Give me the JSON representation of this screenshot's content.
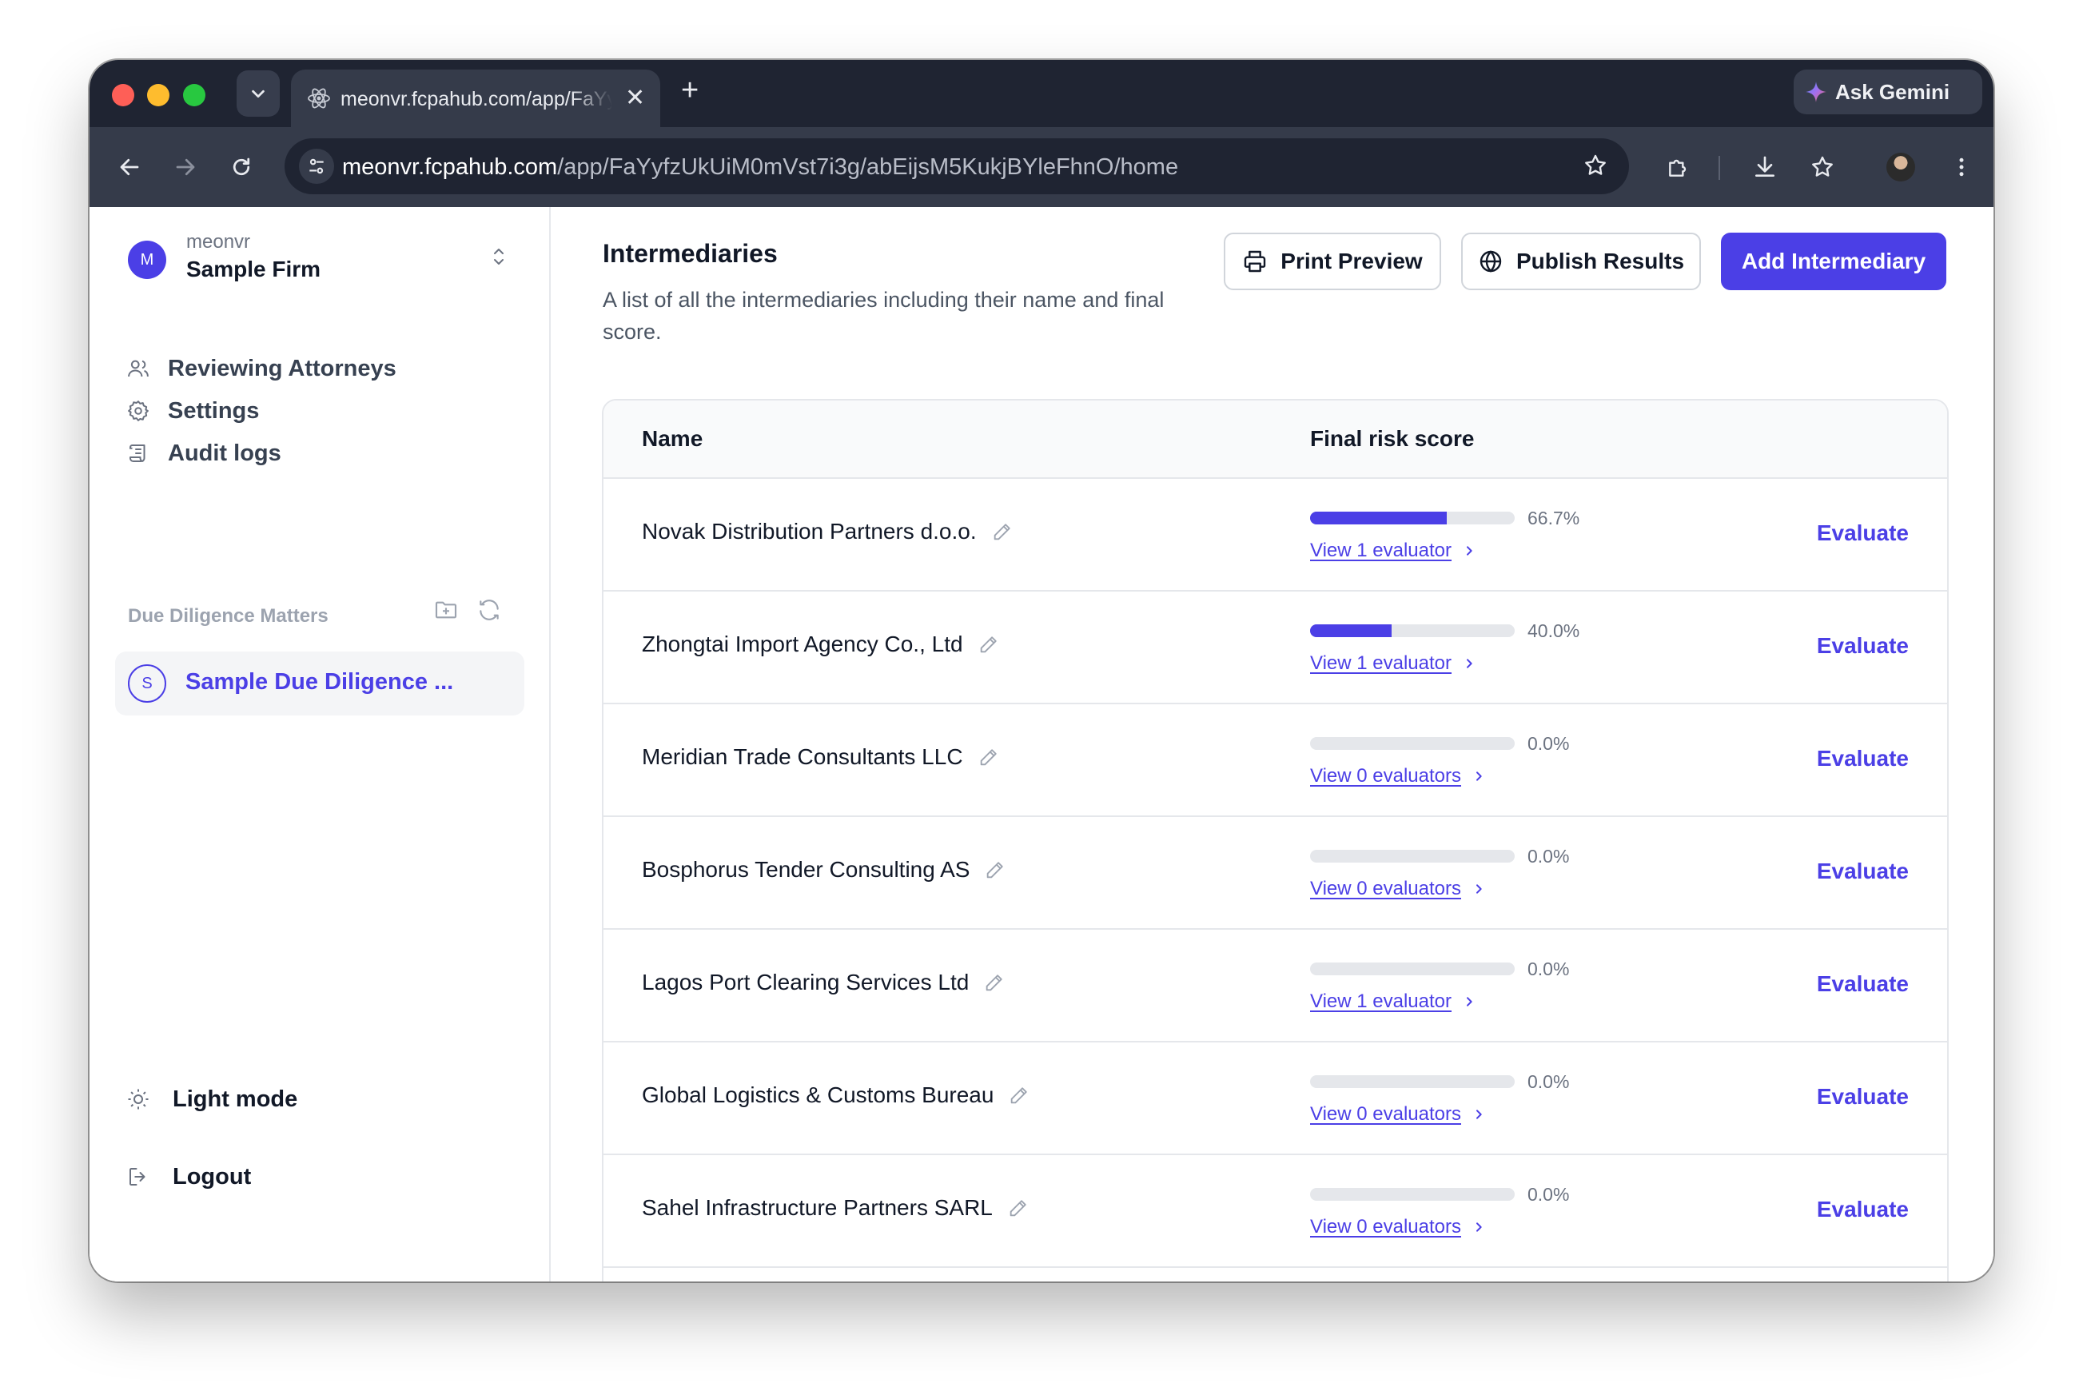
{
  "browser": {
    "tab_title": "meonvr.fcpahub.com/app/FaYyfzUkUiM0mVst7i3g/abEijsM5KukjBYleFhnO/home",
    "url_host": "meonvr.fcpahub.com",
    "url_path": "/app/FaYyfzUkUiM0mVst7i3g/abEijsM5KukjBYleFhnO/home",
    "gemini_label": "Ask Gemini"
  },
  "sidebar": {
    "org_initial": "M",
    "org_user": "meonvr",
    "org_name": "Sample Firm",
    "nav": [
      {
        "label": "Reviewing Attorneys",
        "icon": "users-icon"
      },
      {
        "label": "Settings",
        "icon": "gear-icon"
      },
      {
        "label": "Audit logs",
        "icon": "scroll-icon"
      }
    ],
    "section_label": "Due Diligence Matters",
    "matter_initial": "S",
    "matter_label": "Sample Due Diligence ...",
    "light_mode": "Light mode",
    "logout": "Logout"
  },
  "main": {
    "title": "Intermediaries",
    "description": "A list of all the intermediaries including their name and final score.",
    "print_preview": "Print Preview",
    "publish_results": "Publish Results",
    "add_intermediary": "Add Intermediary",
    "col_name": "Name",
    "col_score": "Final risk score",
    "evaluate_label": "Evaluate",
    "accent": "#4b3fe6",
    "rows": [
      {
        "name": "Novak Distribution Partners d.o.o.",
        "score": 0.667,
        "score_label": "66.7%",
        "evaluators": "View 1 evaluator"
      },
      {
        "name": "Zhongtai Import Agency Co., Ltd",
        "score": 0.4,
        "score_label": "40.0%",
        "evaluators": "View 1 evaluator"
      },
      {
        "name": "Meridian Trade Consultants LLC",
        "score": 0,
        "score_label": "0.0%",
        "evaluators": "View 0 evaluators"
      },
      {
        "name": "Bosphorus Tender Consulting AS",
        "score": 0,
        "score_label": "0.0%",
        "evaluators": "View 0 evaluators"
      },
      {
        "name": "Lagos Port Clearing Services Ltd",
        "score": 0,
        "score_label": "0.0%",
        "evaluators": "View 1 evaluator"
      },
      {
        "name": "Global Logistics & Customs Bureau",
        "score": 0,
        "score_label": "0.0%",
        "evaluators": "View 0 evaluators"
      },
      {
        "name": "Sahel Infrastructure Partners SARL",
        "score": 0,
        "score_label": "0.0%",
        "evaluators": "View 0 evaluators"
      }
    ]
  }
}
